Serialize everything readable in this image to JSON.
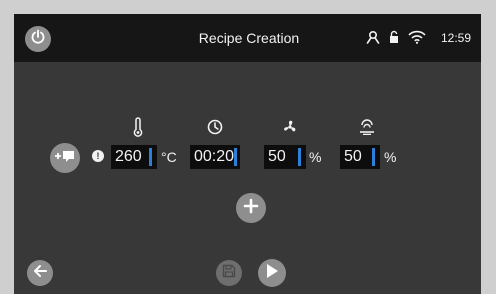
{
  "header": {
    "title": "Recipe Creation",
    "time": "12:59"
  },
  "icons": {
    "power": "power-icon",
    "user": "user-icon",
    "lock": "lock-icon",
    "wifi": "wifi-icon",
    "temperature": "thermometer-icon",
    "time": "clock-icon",
    "fan": "fan-icon",
    "humidity": "steam-icon",
    "add_note": "add-comment-icon",
    "info": "info-icon",
    "add_step": "plus-icon",
    "back": "arrow-left-icon",
    "save": "save-icon",
    "play": "play-icon"
  },
  "step": {
    "info_glyph": "!",
    "temperature": {
      "value": "260",
      "unit": "°C"
    },
    "time": {
      "value": "00:20"
    },
    "fan": {
      "value": "50",
      "unit": "%"
    },
    "humidity": {
      "value": "50",
      "unit": "%"
    }
  },
  "colors": {
    "background": "#383838",
    "topbar": "#161616",
    "button": "#8e8e8e",
    "field": "#0d0d0d",
    "caret": "#2d7fd9",
    "text": "#f2f2f2"
  }
}
